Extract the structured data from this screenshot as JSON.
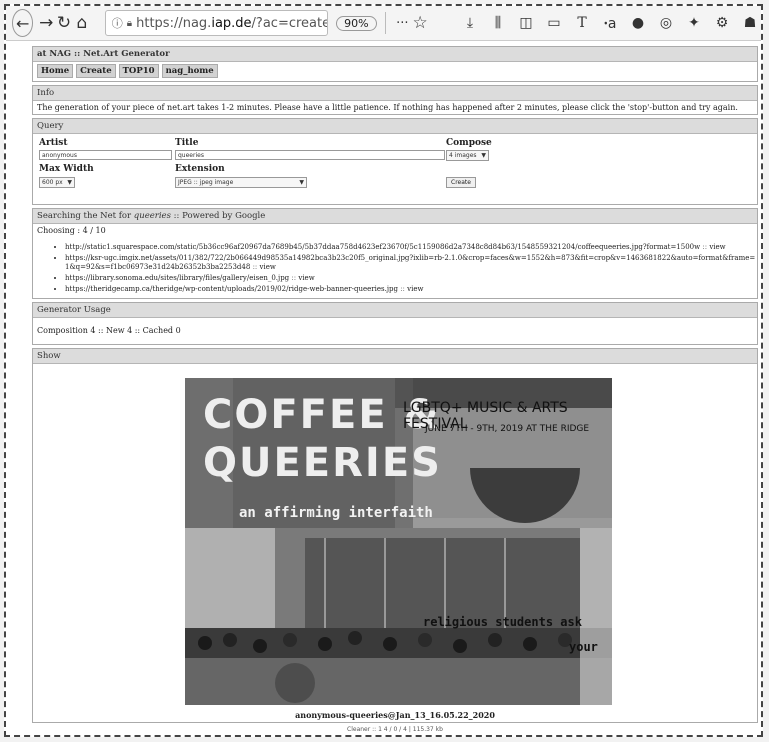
{
  "browser": {
    "url_prefix": "https://nag.",
    "url_domain": "iap.de",
    "url_suffix": "/?ac=create",
    "zoom": "90%"
  },
  "header": {
    "title": "at NAG :: Net.Art Generator",
    "nav": [
      "Home",
      "Create",
      "TOP10",
      "nag_home"
    ]
  },
  "info": {
    "heading": "Info",
    "text": "The generation of your piece of net.art takes 1-2 minutes. Please have a little patience. If nothing has happened after 2 minutes, please click the 'stop'-button and try again."
  },
  "query": {
    "heading": "Query",
    "artist_label": "Artist",
    "artist_value": "anonymous",
    "title_label": "Title",
    "title_value": "queeries",
    "compose_label": "Compose",
    "compose_value": "4 images",
    "maxwidth_label": "Max Width",
    "maxwidth_value": "600 px",
    "extension_label": "Extension",
    "extension_value": "JPEG :: jpeg image",
    "create_label": "Create"
  },
  "search": {
    "heading_prefix": "Searching the Net for",
    "heading_term": "queeries",
    "heading_suffix": ":: Powered by Google",
    "choosing": "Choosing : 4 / 10",
    "view_label": "view",
    "links": [
      "http://static1.squarespace.com/static/5b36cc96af20967da7689b45/5b37ddaa758d4623ef23670f/5c1159086d2a7348c8d84b63/1548559321204/coffeequeeries.jpg?format=1500w",
      "https://ksr-ugc.imgix.net/assets/011/382/722/2b066449d98535a14982bca3b23c20f5_original.jpg?ixlib=rb-2.1.0&crop=faces&w=1552&h=873&fit=crop&v=1463681822&auto=format&frame=1&q=92&s=f1bc06973e31d24b26352b3ba2253d48",
      "https://library.sonoma.edu/sites/library/files/gallery/eisen_0.jpg",
      "https://theridgecamp.ca/theridge/wp-content/uploads/2019/02/ridge-web-banner-queeries.jpg"
    ]
  },
  "usage": {
    "heading": "Generator Usage",
    "text": "Composition 4 :: New 4 :: Cached 0"
  },
  "show": {
    "heading": "Show",
    "caption": "anonymous-queeries@Jan_13_16.05.22_2020",
    "footer": "Cleaner :: 1 4 / 0 / 4 | 115.37 kb",
    "collage_text": {
      "coffee": "COFFEE &",
      "queeries": "QUEERIES",
      "festival": "LGBTQ+ MUSIC & ARTS FESTIVAL",
      "dates": "JUNE 7TH - 9TH, 2019 AT THE RIDGE",
      "affirming": "an affirming interfaith",
      "religious": "religious students ask",
      "your": "your"
    }
  }
}
